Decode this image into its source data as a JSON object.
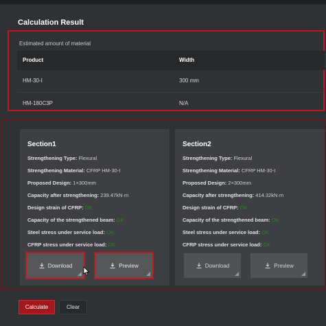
{
  "page": {
    "title": "Calculation Result"
  },
  "material": {
    "label": "Estimated amount of material",
    "columns": [
      "Product",
      "Width"
    ],
    "rows": [
      [
        "HM-30-I",
        "300  mm"
      ],
      [
        "HM-180C3P",
        "N/A"
      ]
    ]
  },
  "sections": [
    {
      "title": "Section1",
      "fields": [
        {
          "label": "Strengthening Type:",
          "value": "Flexural"
        },
        {
          "label": "Strengthening Material:",
          "value": "CFRP HM-30-I"
        },
        {
          "label": "Proposed Design:",
          "value": "1×300mm"
        },
        {
          "label": "Capacity after strengthening:",
          "value": "239.47kN·m"
        },
        {
          "label": "Design strain of CFRP:",
          "value": "OK"
        },
        {
          "label": "Capacity of the strengthened beam:",
          "value": "OK"
        },
        {
          "label": "Steel stress under service load:",
          "value": "OK"
        },
        {
          "label": "CFRP stress under service load:",
          "value": "OK"
        }
      ],
      "download_label": "Download",
      "preview_label": "Preview"
    },
    {
      "title": "Section2",
      "fields": [
        {
          "label": "Strengthening Type:",
          "value": "Flexural"
        },
        {
          "label": "Strengthening Material:",
          "value": "CFRP HM-30-I"
        },
        {
          "label": "Proposed Design:",
          "value": "2×300mm"
        },
        {
          "label": "Capacity after strengthening:",
          "value": "414.32kN·m"
        },
        {
          "label": "Design strain of CFRP:",
          "value": "OK"
        },
        {
          "label": "Capacity of the strengthened beam:",
          "value": "OK"
        },
        {
          "label": "Steel stress under service load:",
          "value": "OK"
        },
        {
          "label": "CFRP stress under service load:",
          "value": "OK"
        }
      ],
      "download_label": "Download",
      "preview_label": "Preview"
    }
  ],
  "actions": {
    "calculate_label": "Calculate",
    "clear_label": "Clear"
  },
  "colors": {
    "accent": "#a4171b",
    "highlight": "#c4161c",
    "ok": "#2f7d2a"
  },
  "icons": {
    "download": "download-icon",
    "cursor": "mouse-pointer-icon"
  }
}
